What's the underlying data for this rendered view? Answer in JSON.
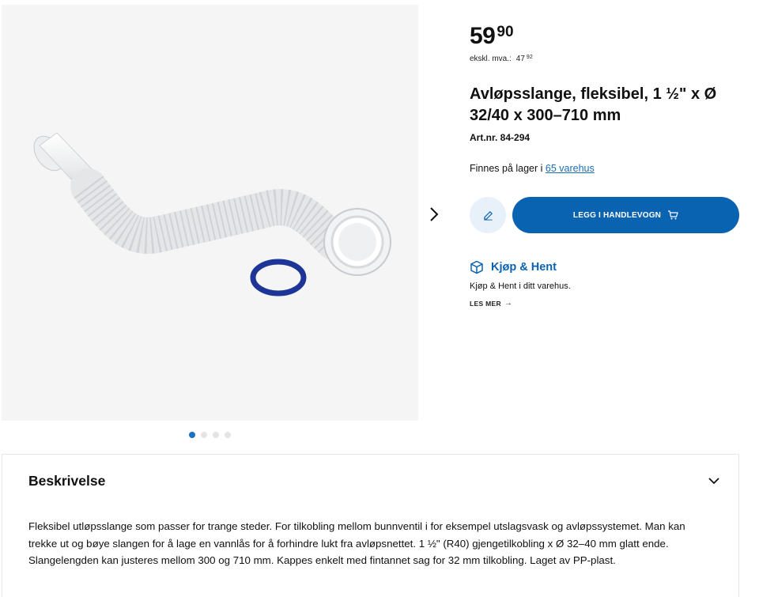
{
  "gallery": {
    "image_alt": "Flexible drain hose with blue gasket",
    "next_icon": "chevron-right-icon",
    "dots_total": 4,
    "active_dot": 1
  },
  "price": {
    "main": "59",
    "decimals": "90",
    "ex_vat_label": "ekskl. mva.:",
    "ex_vat_main": "47",
    "ex_vat_decimals": "92"
  },
  "product": {
    "title": "Avløpsslange, fleksibel, 1 ½\" x Ø 32/40 x 300–710 mm",
    "artnr": "Art.nr. 84-294",
    "stock_text": "Finnes på lager i ",
    "stock_link": "65 varehus"
  },
  "actions": {
    "edit_icon": "pencil-icon",
    "add_to_cart_label": "LEGG I HANDLEVOGN",
    "cart_icon": "cart-icon",
    "accent": "#0a63b0"
  },
  "click_collect": {
    "icon": "box-icon",
    "title": "Kjøp & Hent",
    "description": "Kjøp & Hent i ditt varehus.",
    "read_more": "LES MER",
    "arrow": "→"
  },
  "description": {
    "heading": "Beskrivelse",
    "chevron_icon": "chevron-down-icon",
    "body": "Fleksibel utløpsslange som passer for trange steder. For tilkobling mellom bunnventil i for eksempel utslagsvask og avløpssystemet. Man kan trekke ut og bøye slangen for å lage en vannlås for å forhindre lukt fra avløpsnettet. 1 ½\" (R40) gjengetilkobling x Ø 32–40 mm glatt ende. Slangelengden kan justeres mellom 300 og 710 mm. Kappes enkelt med fintannet sag for 32 mm tilkobling. Laget av PP-plast."
  }
}
